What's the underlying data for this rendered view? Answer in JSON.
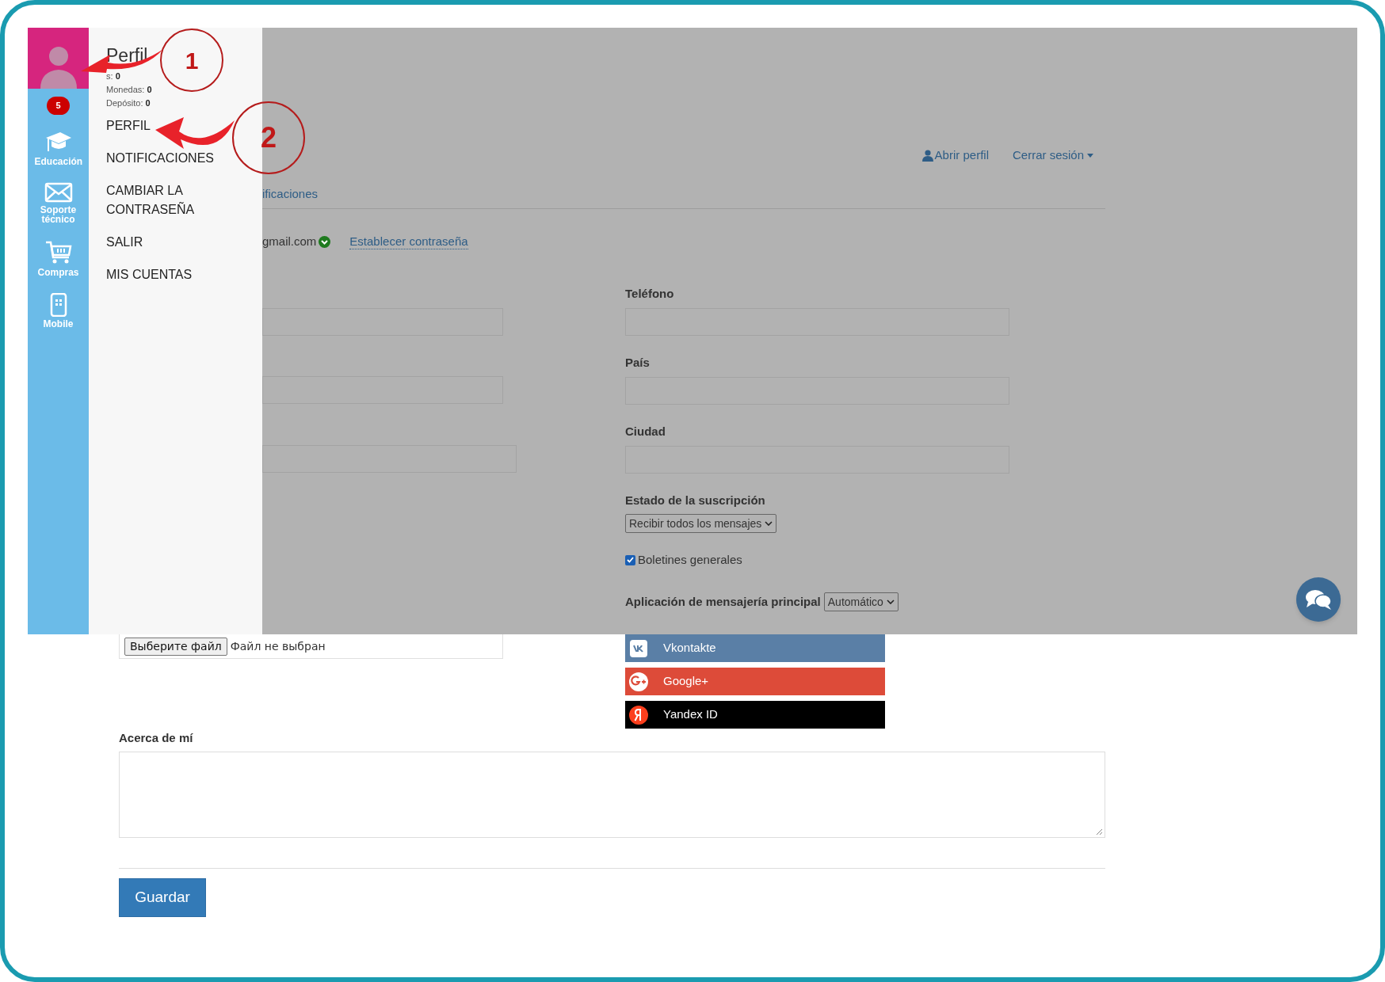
{
  "sidebar": {
    "badge": "5",
    "items": [
      {
        "kind": "education",
        "label": "Educación"
      },
      {
        "kind": "support",
        "label": "Soporte técnico"
      },
      {
        "kind": "shop",
        "label": "Compras"
      },
      {
        "kind": "mobile",
        "label": "Mobile"
      }
    ]
  },
  "menu": {
    "title": "Perfil",
    "stats": [
      {
        "label": "s:",
        "value": "0"
      },
      {
        "label": "Monedas:",
        "value": "0"
      },
      {
        "label": "Depósito:",
        "value": "0"
      }
    ],
    "items": [
      "PERFIL",
      "NOTIFICACIONES",
      "CAMBIAR LA CONTRASEÑA",
      "SALIR",
      "MIS CUENTAS"
    ]
  },
  "header": {
    "open_profile": "Abrir perfil",
    "logout": "Cerrar sesión"
  },
  "tab_label": "ificaciones",
  "email": {
    "value": "gmail.com",
    "verified": true
  },
  "set_password_link": "Establecer contraseña",
  "right_fields": [
    {
      "label": "Teléfono"
    },
    {
      "label": "País"
    },
    {
      "label": "Ciudad"
    }
  ],
  "subscription": {
    "label": "Estado de la suscripción",
    "value": "Recibir todos los mensajes"
  },
  "newsletter": {
    "label": "Boletines generales",
    "checked": true
  },
  "messenger": {
    "label": "Aplicación de mensajería principal",
    "value": "Automático"
  },
  "file_input": {
    "button": "Выберите файл",
    "status": "Файл не выбран"
  },
  "social": [
    {
      "kind": "vk",
      "label": "Vkontakte",
      "color": "#5a7fa6"
    },
    {
      "kind": "google",
      "label": "Google+",
      "color": "#dd4b39"
    },
    {
      "kind": "yandex",
      "label": "Yandex ID",
      "color": "#000000"
    }
  ],
  "about": {
    "label": "Acerca de mí"
  },
  "save_button": "Guardar",
  "annotations": [
    {
      "number": "1"
    },
    {
      "number": "2"
    }
  ]
}
